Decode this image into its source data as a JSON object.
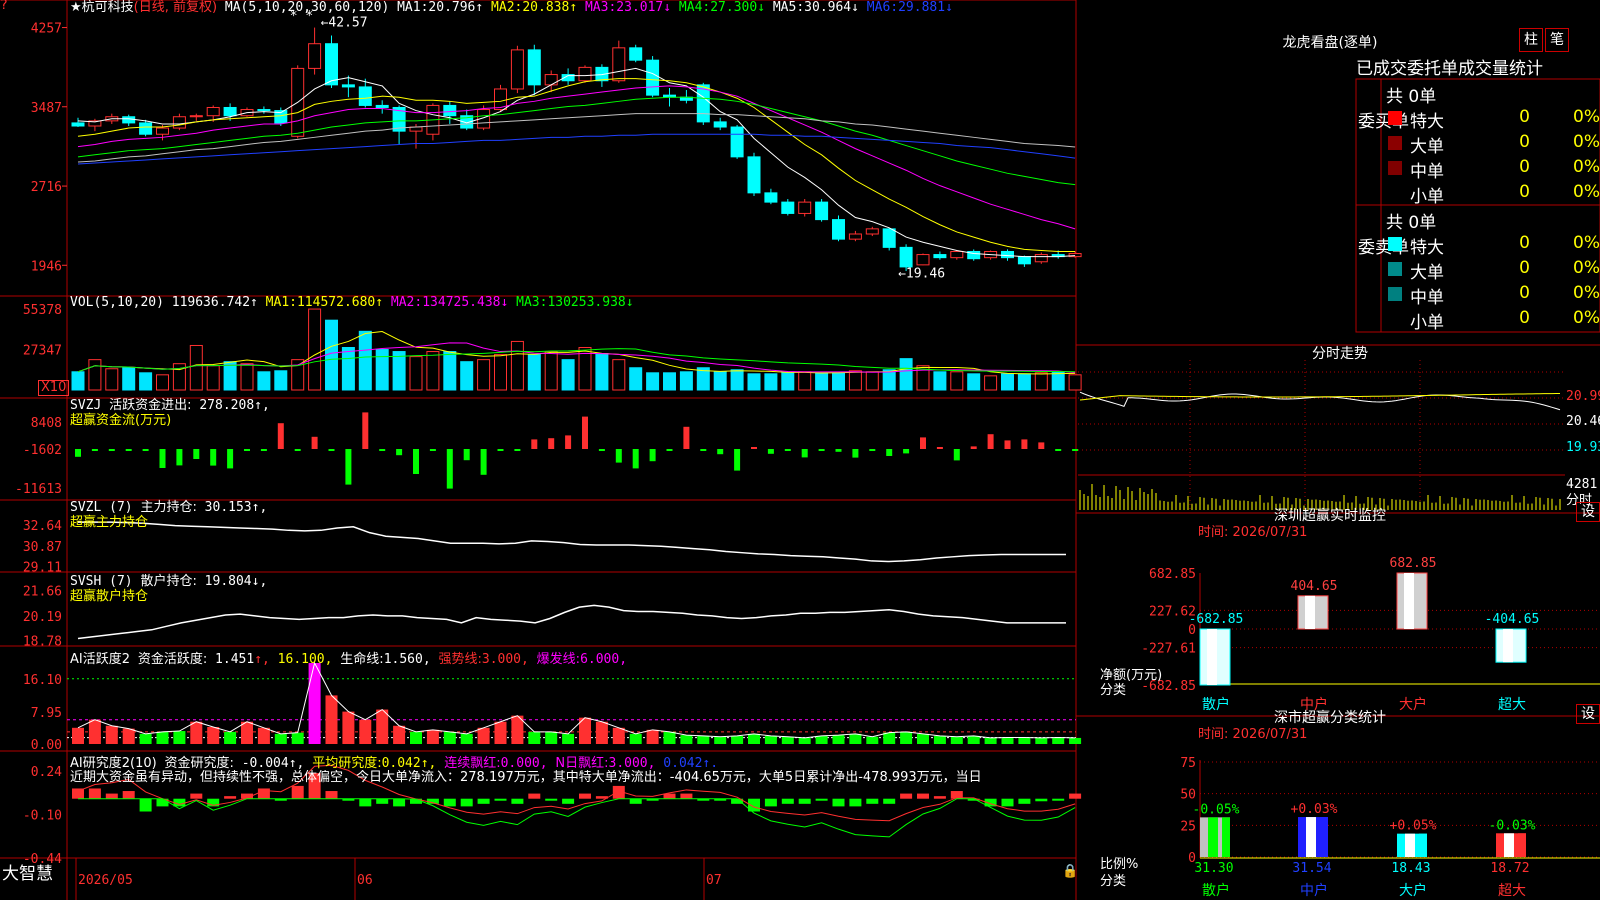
{
  "colors": {
    "up": "#ff3030",
    "down": "#00ffff",
    "vol_down": "#00e5ff",
    "grid": "#b00000",
    "ma1": "#ffffff",
    "ma2": "#ffff00",
    "ma3": "#ff00ff",
    "ma4": "#00ff00",
    "ma5": "#c0c0c0",
    "ma6": "#2040ff",
    "green": "#00ff00"
  },
  "price_panel": {
    "title": "★杭可科技",
    "mode": "(日线, 前复权)",
    "ma_label": "MA(5,10,20,30,60,120)",
    "ma_values": [
      {
        "label": "MA1:",
        "value": "20.796↑",
        "color": "#ffffff"
      },
      {
        "label": "MA2:",
        "value": "20.838↑",
        "color": "#ffff00"
      },
      {
        "label": "MA3:",
        "value": "23.017↓",
        "color": "#ff00ff"
      },
      {
        "label": "MA4:",
        "value": "27.300↓",
        "color": "#00ff00"
      },
      {
        "label": "MA5:",
        "value": "30.964↓",
        "color": "#ffffff"
      },
      {
        "label": "MA6:",
        "value": "29.881↓",
        "color": "#2040ff"
      }
    ],
    "y_ticks": [
      "4257",
      "3487",
      "2716",
      "1946"
    ],
    "high_marker": "←42.57",
    "low_marker": "←19.46",
    "stars": "* *",
    "candles": [
      [
        33.3,
        33.8,
        32.9,
        33.0
      ],
      [
        33.0,
        33.7,
        32.5,
        33.5
      ],
      [
        33.5,
        34.2,
        33.2,
        33.9
      ],
      [
        33.9,
        34.1,
        33.0,
        33.3
      ],
      [
        33.3,
        33.6,
        32.0,
        32.2
      ],
      [
        32.2,
        33.1,
        31.6,
        32.8
      ],
      [
        32.8,
        34.2,
        32.6,
        33.9
      ],
      [
        33.9,
        34.2,
        33.5,
        34.0
      ],
      [
        34.0,
        35.0,
        33.4,
        34.8
      ],
      [
        34.8,
        35.2,
        33.5,
        34.0
      ],
      [
        34.0,
        34.8,
        33.9,
        34.6
      ],
      [
        34.6,
        34.9,
        34.2,
        34.5
      ],
      [
        34.5,
        34.8,
        33.0,
        33.3
      ],
      [
        32.0,
        38.9,
        31.8,
        38.6
      ],
      [
        38.6,
        42.57,
        38.0,
        41.0
      ],
      [
        41.0,
        41.8,
        36.7,
        37.0
      ],
      [
        37.0,
        37.9,
        35.8,
        36.8
      ],
      [
        36.8,
        37.6,
        34.8,
        35.0
      ],
      [
        35.0,
        35.5,
        34.2,
        34.8
      ],
      [
        34.8,
        35.0,
        31.2,
        32.5
      ],
      [
        32.5,
        33.2,
        30.8,
        32.9
      ],
      [
        32.2,
        35.2,
        31.6,
        35.0
      ],
      [
        35.0,
        35.4,
        33.2,
        34.0
      ],
      [
        34.0,
        34.6,
        32.6,
        32.8
      ],
      [
        32.8,
        35.0,
        32.6,
        34.6
      ],
      [
        34.6,
        37.0,
        34.4,
        36.6
      ],
      [
        36.6,
        40.8,
        36.2,
        40.4
      ],
      [
        40.4,
        40.9,
        36.0,
        37.0
      ],
      [
        37.0,
        38.4,
        36.3,
        38.0
      ],
      [
        38.0,
        38.6,
        37.0,
        37.4
      ],
      [
        37.4,
        38.9,
        37.2,
        38.7
      ],
      [
        38.7,
        39.0,
        36.8,
        37.4
      ],
      [
        37.4,
        41.3,
        37.2,
        40.6
      ],
      [
        40.6,
        40.9,
        39.2,
        39.4
      ],
      [
        39.4,
        39.8,
        35.8,
        36.0
      ],
      [
        36.0,
        36.7,
        34.9,
        35.8
      ],
      [
        35.8,
        36.5,
        35.2,
        35.5
      ],
      [
        37.0,
        37.2,
        33.1,
        33.4
      ],
      [
        33.4,
        33.8,
        32.6,
        32.9
      ],
      [
        32.9,
        33.1,
        29.8,
        30.0
      ],
      [
        30.0,
        30.4,
        26.2,
        26.5
      ],
      [
        26.5,
        26.9,
        25.4,
        25.6
      ],
      [
        25.6,
        25.9,
        24.3,
        24.5
      ],
      [
        24.5,
        25.9,
        24.2,
        25.6
      ],
      [
        25.6,
        25.9,
        23.7,
        23.9
      ],
      [
        23.9,
        24.3,
        21.8,
        22.0
      ],
      [
        22.0,
        22.8,
        21.8,
        22.5
      ],
      [
        22.5,
        23.2,
        22.3,
        23.0
      ],
      [
        23.0,
        23.1,
        20.9,
        21.2
      ],
      [
        21.2,
        21.5,
        18.9,
        19.3
      ],
      [
        19.5,
        20.6,
        19.46,
        20.5
      ],
      [
        20.5,
        20.8,
        20.0,
        20.2
      ],
      [
        20.2,
        20.9,
        20.0,
        20.8
      ],
      [
        20.8,
        21.0,
        19.9,
        20.1
      ],
      [
        20.2,
        20.9,
        20.0,
        20.8
      ],
      [
        20.8,
        21.0,
        19.9,
        20.2
      ],
      [
        20.3,
        20.4,
        19.3,
        19.6
      ],
      [
        19.8,
        20.7,
        19.6,
        20.5
      ],
      [
        20.5,
        20.9,
        20.1,
        20.3
      ],
      [
        20.3,
        20.8,
        20.2,
        20.6
      ]
    ],
    "ma_lines": {
      "ma1": [
        33.5,
        33.4,
        33.7,
        33.7,
        33.5,
        33.2,
        33.2,
        33.4,
        33.6,
        33.9,
        34.3,
        34.4,
        34.3,
        35.3,
        36.6,
        37.4,
        37.7,
        37.3,
        36.9,
        35.2,
        34.5,
        34.1,
        33.8,
        33.3,
        33.8,
        34.4,
        35.5,
        36.1,
        37.0,
        37.9,
        37.9,
        38.0,
        38.3,
        38.6,
        38.1,
        37.2,
        36.9,
        35.8,
        34.4,
        33.6,
        31.8,
        30.4,
        29.0,
        28.0,
        26.8,
        25.3,
        24.1,
        23.7,
        23.1,
        22.2,
        21.7,
        21.3,
        20.9,
        20.6,
        20.5,
        20.4,
        20.3,
        20.3,
        20.3,
        20.4
      ],
      "ma2": [
        32.0,
        32.2,
        32.5,
        32.8,
        32.9,
        32.9,
        33.1,
        33.4,
        33.6,
        33.7,
        33.8,
        33.9,
        34.0,
        34.3,
        35.1,
        35.4,
        35.6,
        35.7,
        35.9,
        35.8,
        35.5,
        35.5,
        35.4,
        35.2,
        35.3,
        35.4,
        35.8,
        35.9,
        36.4,
        36.9,
        37.3,
        37.5,
        37.6,
        37.6,
        37.5,
        37.4,
        37.2,
        36.8,
        36.3,
        35.7,
        34.8,
        33.6,
        32.4,
        31.2,
        30.2,
        28.9,
        27.7,
        26.8,
        25.9,
        25.1,
        24.2,
        23.4,
        22.7,
        22.2,
        21.7,
        21.3,
        21.0,
        20.9,
        20.8,
        20.8
      ],
      "ma3": [
        31.0,
        31.2,
        31.5,
        31.7,
        31.8,
        31.9,
        32.1,
        32.3,
        32.6,
        32.8,
        33.0,
        33.2,
        33.2,
        33.5,
        34.0,
        34.3,
        34.6,
        34.7,
        34.7,
        34.5,
        34.3,
        34.3,
        34.4,
        34.5,
        34.7,
        34.8,
        35.2,
        35.4,
        35.7,
        35.9,
        36.1,
        36.3,
        36.5,
        36.7,
        36.8,
        36.9,
        36.8,
        36.6,
        36.3,
        35.9,
        35.2,
        34.5,
        33.8,
        33.1,
        32.4,
        31.6,
        30.8,
        30.1,
        29.4,
        28.7,
        27.9,
        27.2,
        26.6,
        26.0,
        25.4,
        24.9,
        24.4,
        23.9,
        23.5,
        23.0
      ],
      "ma4": [
        30.0,
        30.2,
        30.4,
        30.6,
        30.7,
        30.8,
        31.0,
        31.2,
        31.4,
        31.6,
        31.8,
        32.0,
        32.1,
        32.3,
        32.6,
        32.9,
        33.1,
        33.3,
        33.4,
        33.5,
        33.5,
        33.6,
        33.7,
        33.8,
        34.0,
        34.1,
        34.3,
        34.5,
        34.7,
        34.9,
        35.0,
        35.2,
        35.4,
        35.6,
        35.7,
        35.8,
        35.8,
        35.7,
        35.6,
        35.4,
        35.1,
        34.7,
        34.3,
        33.9,
        33.5,
        33.0,
        32.5,
        32.1,
        31.6,
        31.1,
        30.6,
        30.1,
        29.6,
        29.2,
        28.8,
        28.4,
        28.1,
        27.8,
        27.5,
        27.3
      ],
      "ma5": [
        29.5,
        29.6,
        29.8,
        30.0,
        30.1,
        30.3,
        30.5,
        30.7,
        30.8,
        31.0,
        31.2,
        31.4,
        31.5,
        31.7,
        31.9,
        32.1,
        32.3,
        32.5,
        32.6,
        32.8,
        32.9,
        33.0,
        33.1,
        33.2,
        33.3,
        33.4,
        33.5,
        33.6,
        33.7,
        33.8,
        33.9,
        34.0,
        34.1,
        34.2,
        34.2,
        34.2,
        34.2,
        34.2,
        34.1,
        34.1,
        34.0,
        33.9,
        33.8,
        33.7,
        33.5,
        33.4,
        33.2,
        33.1,
        32.9,
        32.7,
        32.5,
        32.3,
        32.1,
        31.9,
        31.7,
        31.5,
        31.3,
        31.2,
        31.1,
        30.96
      ],
      "ma6": [
        29.3,
        29.4,
        29.5,
        29.6,
        29.7,
        29.8,
        29.9,
        30.0,
        30.1,
        30.2,
        30.3,
        30.4,
        30.5,
        30.6,
        30.7,
        30.8,
        30.9,
        31.0,
        31.1,
        31.2,
        31.3,
        31.3,
        31.4,
        31.5,
        31.6,
        31.6,
        31.7,
        31.8,
        31.9,
        31.9,
        32.0,
        32.0,
        32.1,
        32.1,
        32.2,
        32.2,
        32.2,
        32.2,
        32.2,
        32.2,
        32.2,
        32.1,
        32.1,
        32.0,
        32.0,
        31.9,
        31.8,
        31.7,
        31.6,
        31.5,
        31.4,
        31.3,
        31.1,
        31.0,
        30.9,
        30.7,
        30.5,
        30.3,
        30.1,
        29.88
      ]
    }
  },
  "vol_panel": {
    "label": "VOL(5,10,20)",
    "value": "119636.742↑",
    "ma_values": [
      {
        "label": "MA1:",
        "value": "114572.680↑",
        "color": "#ffff00"
      },
      {
        "label": "MA2:",
        "value": "134725.438↓",
        "color": "#ff00ff"
      },
      {
        "label": "MA3:",
        "value": "130253.938↓",
        "color": "#00ff00"
      }
    ],
    "y_ticks": [
      "55378",
      "27347"
    ],
    "unit": "X10",
    "volumes": [
      18,
      30,
      21,
      22,
      17,
      15,
      26,
      44,
      24,
      28,
      26,
      18,
      19,
      30,
      80,
      69,
      42,
      58,
      40,
      38,
      33,
      38,
      38,
      28,
      30,
      35,
      48,
      35,
      38,
      30,
      42,
      36,
      30,
      22,
      17,
      17,
      18,
      22,
      18,
      20,
      16,
      16,
      17,
      18,
      17,
      17,
      19,
      18,
      20,
      31,
      24,
      18,
      18,
      16,
      14,
      16,
      16,
      17,
      18,
      15
    ]
  },
  "svzj_panel": {
    "label": "SVZJ",
    "name": "活跃资金进出:",
    "value": "278.208↑,",
    "subtitle": "超赢资金流(万元)",
    "y_ticks": [
      "8408",
      "-1602",
      "-11613"
    ],
    "values": [
      -4.4,
      -0.5,
      -0.5,
      -0.5,
      -0.5,
      -10.0,
      -8.7,
      -5.5,
      -8.8,
      -10.2,
      -0.5,
      -0.5,
      12.4,
      -0.5,
      5.6,
      -0.5,
      -18.3,
      17.8,
      -0.5,
      -3.6,
      -13.0,
      -0.5,
      -20.3,
      -6.1,
      -13.4,
      -0.5,
      -0.5,
      4.3,
      4.9,
      6.3,
      15.7,
      -0.5,
      -7.3,
      -10.2,
      -6.6,
      -0.5,
      10.6,
      -0.5,
      -3.1,
      -11.3,
      0.5,
      -2.9,
      -0.5,
      -4.7,
      -0.5,
      -1.9,
      -4.8,
      -0.5,
      -4.0,
      -2.7,
      5.3,
      0.5,
      -6.2,
      0.8,
      6.9,
      3.8,
      4.3,
      2.8,
      -1.0,
      -0.5,
      -0.5,
      -0.5,
      -0.3
    ]
  },
  "svzl_panel": {
    "label": "SVZL",
    "params": "(7)",
    "name": "主力持仓:",
    "value": "30.153↑,",
    "subtitle": "超赢主力持仓",
    "y_ticks": [
      "32.64",
      "30.87",
      "29.11"
    ],
    "values": [
      32.9,
      32.9,
      32.9,
      32.85,
      32.8,
      32.7,
      32.6,
      32.55,
      32.5,
      32.45,
      32.4,
      32.35,
      32.3,
      32.2,
      32.15,
      32.2,
      32.4,
      32.5,
      32.0,
      31.7,
      31.6,
      31.5,
      31.3,
      31.1,
      31.1,
      31.1,
      31.05,
      31.1,
      31.3,
      31.25,
      31.15,
      31.0,
      30.95,
      30.95,
      30.95,
      30.9,
      30.85,
      30.75,
      30.65,
      30.55,
      30.4,
      30.3,
      30.2,
      30.15,
      30.05,
      30.0,
      29.95,
      29.85,
      29.75,
      29.6,
      29.55,
      29.6,
      29.7,
      29.85,
      29.95,
      30.05,
      30.1,
      30.15,
      30.15,
      30.15,
      30.15,
      30.15
    ]
  },
  "svsh_panel": {
    "label": "SVSH",
    "params": "(7)",
    "name": "散户持仓:",
    "value": "19.804↓,",
    "subtitle": "超赢散户持仓",
    "y_ticks": [
      "21.66",
      "20.19",
      "18.78"
    ],
    "values": [
      18.9,
      19.0,
      19.1,
      19.2,
      19.3,
      19.4,
      19.6,
      19.8,
      19.95,
      20.1,
      20.25,
      20.3,
      20.2,
      20.1,
      20.05,
      20.0,
      20.05,
      20.1,
      20.1,
      20.2,
      20.25,
      20.2,
      20.2,
      20.1,
      20.05,
      20.0,
      19.8,
      20.1,
      20.0,
      19.95,
      19.9,
      19.8,
      20.05,
      20.4,
      20.7,
      20.8,
      20.7,
      20.5,
      20.45,
      20.45,
      20.4,
      20.35,
      20.25,
      20.2,
      20.1,
      20.05,
      20.1,
      20.2,
      20.25,
      20.35,
      20.35,
      20.4,
      20.4,
      20.45,
      20.5,
      20.55,
      20.45,
      20.3,
      20.2,
      20.15,
      20.1,
      20.0,
      19.9,
      19.8,
      19.8,
      19.8,
      19.8,
      19.8
    ]
  },
  "ai_active_panel": {
    "label": "AI活跃度2",
    "name": "资金活跃度:",
    "value": "1.451",
    "up_mark": "↑,",
    "val2": "16.100,",
    "name3": "生命线:",
    "val3": "1.560,",
    "name4": "强势线:",
    "val4": "3.000,",
    "name5": "爆发线:",
    "val5": "6.000,",
    "y_ticks": [
      "16.10",
      "7.95",
      "0.00"
    ],
    "values": [
      4.0,
      6.0,
      4.5,
      3.8,
      2.5,
      3.0,
      3.2,
      5.5,
      4.2,
      3.0,
      5.5,
      4.0,
      2.5,
      2.8,
      20.0,
      12.0,
      8.0,
      6.0,
      8.5,
      4.5,
      3.0,
      3.5,
      3.0,
      2.5,
      4.0,
      5.5,
      7.0,
      3.0,
      3.0,
      2.5,
      6.5,
      5.5,
      4.0,
      2.5,
      3.5,
      3.0,
      2.2,
      2.0,
      1.8,
      2.0,
      2.5,
      2.0,
      1.8,
      1.5,
      2.0,
      2.2,
      2.5,
      1.8,
      2.8,
      3.0,
      2.5,
      2.0,
      1.8,
      2.0,
      1.5,
      1.6,
      1.6,
      1.5,
      1.6,
      1.5,
      1.5,
      1.5
    ]
  },
  "ai_research_panel": {
    "label": "AI研究度2(10)",
    "name": "资金研究度:",
    "value": "-0.004↑,",
    "name2": "平均研究度:",
    "val2": "0.042↑,",
    "name3": "连续飘红:",
    "val3": "0.000,",
    "name4": "N日飘红:",
    "val4": "3.000,",
    "val5": "0.042↑.",
    "commentary": "近期大资金虽有异动，但持续性不强，总体偏空，今日大单净流入：278.197万元，其中特大单净流出：-404.65万元，大单5日累计净出-478.993万元，当日",
    "y_ticks": [
      "0.24",
      "-0.10",
      "-0.44"
    ],
    "values": [
      0.04,
      0.04,
      0.02,
      0.03,
      -0.05,
      -0.03,
      -0.03,
      0.02,
      -0.03,
      0.01,
      0.02,
      0.04,
      0.0,
      0.05,
      0.1,
      0.03,
      0.0,
      -0.03,
      -0.02,
      -0.03,
      -0.02,
      -0.02,
      -0.03,
      -0.03,
      -0.02,
      0.0,
      -0.02,
      0.02,
      0.0,
      -0.02,
      0.02,
      0.01,
      0.05,
      -0.02,
      0.0,
      0.02,
      0.02,
      0.0,
      0.0,
      -0.02,
      -0.05,
      -0.03,
      -0.02,
      -0.02,
      0.0,
      -0.03,
      -0.03,
      -0.02,
      -0.02,
      0.02,
      0.02,
      0.01,
      0.03,
      0.0,
      -0.03,
      -0.03,
      -0.02,
      -0.01,
      0.0,
      0.02,
      0.0
    ]
  },
  "x_axis": {
    "labels": [
      "2026/05",
      "06",
      "07"
    ]
  },
  "logo": "大智慧",
  "right": {
    "top_title": "龙虎看盘(逐单)",
    "btn_bar": "柱",
    "btn_pen": "笔",
    "table_title": "已成交委托单成交量统计",
    "buy": {
      "side": "委买单",
      "count": "共 0单",
      "rows": [
        {
          "name": "特大",
          "val": "0",
          "pct": "0%",
          "color": "#ff0000"
        },
        {
          "name": "大单",
          "val": "0",
          "pct": "0%",
          "color": "#8b0000"
        },
        {
          "name": "中单",
          "val": "0",
          "pct": "0%",
          "color": "#800000"
        },
        {
          "name": "小单",
          "val": "0",
          "pct": "0%",
          "color": ""
        }
      ]
    },
    "sell": {
      "side": "委卖单",
      "count": "共 0单",
      "rows": [
        {
          "name": "特大",
          "val": "0",
          "pct": "0%",
          "color": "#00ffff"
        },
        {
          "name": "大单",
          "val": "0",
          "pct": "0%",
          "color": "#008b8b"
        },
        {
          "name": "中单",
          "val": "0",
          "pct": "0%",
          "color": "#008080"
        },
        {
          "name": "小单",
          "val": "0",
          "pct": "0%",
          "color": ""
        }
      ]
    },
    "intraday": {
      "title": "分时走势",
      "price_ticks": [
        "20.99",
        "20.46",
        "19.93"
      ],
      "vol_tick": "4281",
      "vol_unit": "分时"
    },
    "sz_monitor": {
      "title": "深圳超赢实时监控",
      "settings": "设",
      "time": "时间: 2026/07/31",
      "y_ticks": [
        "682.85",
        "227.62",
        "0",
        "-227.61",
        "-682.85"
      ],
      "ylabel": "净额(万元)",
      "xlabel": "分类",
      "bars": [
        {
          "cat": "散户",
          "value": -682.85,
          "label": "-682.85"
        },
        {
          "cat": "中户",
          "value": 404.65,
          "label": "404.65"
        },
        {
          "cat": "大户",
          "value": 682.85,
          "label": "682.85"
        },
        {
          "cat": "超大",
          "value": -404.65,
          "label": "-404.65"
        }
      ]
    },
    "sh_stats": {
      "title": "深市超赢分类统计",
      "settings": "设",
      "time": "时间: 2026/07/31",
      "y_ticks": [
        "75",
        "50",
        "25",
        "0"
      ],
      "ylabel": "比例%",
      "xlabel": "分类",
      "bars": [
        {
          "cat": "散户",
          "value": 31.3,
          "change": "-0.05%"
        },
        {
          "cat": "中户",
          "value": 31.54,
          "change": "+0.03%"
        },
        {
          "cat": "大户",
          "value": 18.43,
          "change": "+0.05%"
        },
        {
          "cat": "超大",
          "value": 18.72,
          "change": "-0.03%"
        }
      ]
    }
  }
}
